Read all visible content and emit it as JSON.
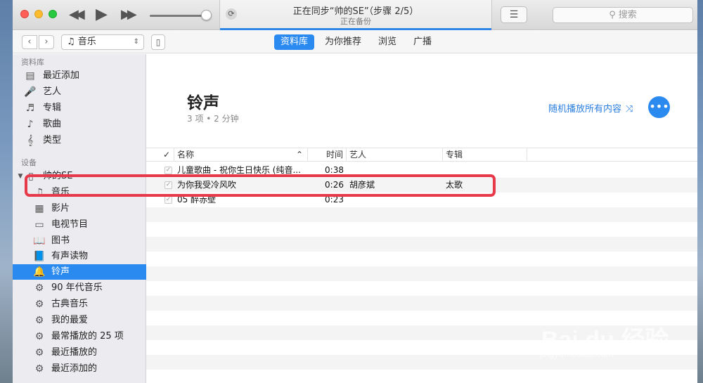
{
  "toolbar": {
    "rewind_icon": "rewind-icon",
    "play_icon": "play-icon",
    "forward_icon": "fast-forward-icon",
    "status_title": "正在同步“帅的SE”（步骤 2/5）",
    "status_subtitle": "正在备份",
    "search_placeholder": "搜索",
    "search_glyph": "⚲"
  },
  "nav": {
    "back": "‹",
    "forward": "›",
    "media_kind": "♫ 音乐",
    "device_glyph": "▯",
    "tabs": [
      {
        "label": "资料库",
        "active": true
      },
      {
        "label": "为你推荐",
        "active": false
      },
      {
        "label": "浏览",
        "active": false
      },
      {
        "label": "广播",
        "active": false
      }
    ]
  },
  "sidebar": {
    "library_title": "资料库",
    "library_items": [
      {
        "icon": "▤",
        "label": "最近添加"
      },
      {
        "icon": "🎤",
        "label": "艺人"
      },
      {
        "icon": "♬",
        "label": "专辑"
      },
      {
        "icon": "♪",
        "label": "歌曲"
      },
      {
        "icon": "𝄞",
        "label": "类型"
      }
    ],
    "devices_title": "设备",
    "device_name": "帅的SE",
    "device_items": [
      {
        "icon": "♫",
        "label": "音乐"
      },
      {
        "icon": "▦",
        "label": "影片"
      },
      {
        "icon": "▭",
        "label": "电视节目"
      },
      {
        "icon": "📖",
        "label": "图书"
      },
      {
        "icon": "📘",
        "label": "有声读物"
      },
      {
        "icon": "🔔",
        "label": "铃声",
        "active": true
      },
      {
        "icon": "⚙",
        "label": "90 年代音乐"
      },
      {
        "icon": "⚙",
        "label": "古典音乐"
      },
      {
        "icon": "⚙",
        "label": "我的最爱"
      },
      {
        "icon": "⚙",
        "label": "最常播放的 25 项"
      },
      {
        "icon": "⚙",
        "label": "最近播放的"
      },
      {
        "icon": "⚙",
        "label": "最近添加的"
      }
    ]
  },
  "main": {
    "title": "铃声",
    "subtitle": "3 项 • 2 分钟",
    "shuffle_label": "随机播放所有内容",
    "shuffle_glyph": "⤨",
    "more_glyph": "•••",
    "columns": {
      "check": "✓",
      "name": "名称",
      "sort": "⌃",
      "time": "时间",
      "artist": "艺人",
      "album": "专辑"
    },
    "rows": [
      {
        "name": "儿童歌曲 - 祝你生日快乐 (纯音...",
        "time": "0:38",
        "artist": "",
        "album": ""
      },
      {
        "name": "为你我受冷风吹",
        "time": "0:26",
        "artist": "胡彦斌",
        "album": "太歌"
      },
      {
        "name": "05 醉赤壁",
        "time": "0:23",
        "artist": "",
        "album": ""
      }
    ]
  },
  "watermark": {
    "brand": "Bai du 经验",
    "url": "jingyan.baidu.com"
  }
}
